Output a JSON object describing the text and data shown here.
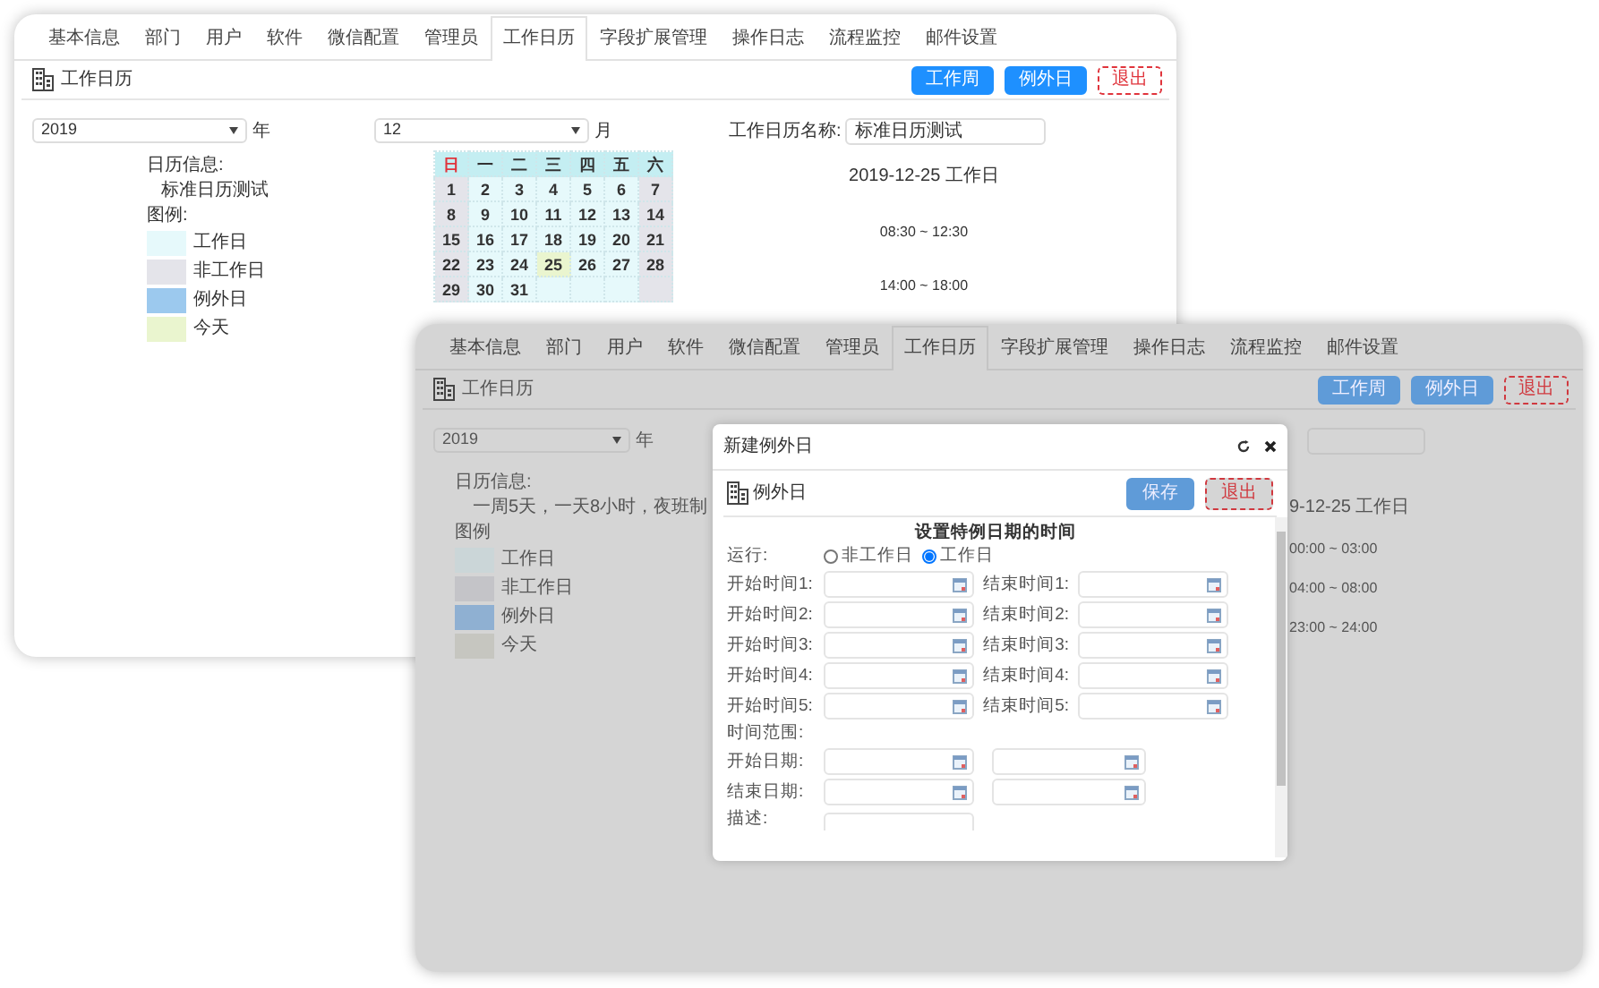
{
  "back_window": {
    "tabs": [
      {
        "label": "基本信息",
        "selected": false
      },
      {
        "label": "部门",
        "selected": false
      },
      {
        "label": "用户",
        "selected": false
      },
      {
        "label": "软件",
        "selected": false
      },
      {
        "label": "微信配置",
        "selected": false
      },
      {
        "label": "管理员",
        "selected": false
      },
      {
        "label": "工作日历",
        "selected": true
      },
      {
        "label": "字段扩展管理",
        "selected": false
      },
      {
        "label": "操作日志",
        "selected": false
      },
      {
        "label": "流程监控",
        "selected": false
      },
      {
        "label": "邮件设置",
        "selected": false
      }
    ],
    "page_title": "工作日历",
    "buttons": [
      {
        "label": "工作周",
        "kind": "primary"
      },
      {
        "label": "例外日",
        "kind": "primary"
      },
      {
        "label": "退出",
        "kind": "danger"
      }
    ],
    "year_select": "2019",
    "year_label": "年",
    "month_select": "12",
    "month_label": "月",
    "name_label": "工作日历名称:",
    "name_value": "标准日历测试",
    "info_label": "日历信息:",
    "info_text": "标准日历测试",
    "legend_label": "图例:",
    "legend": [
      {
        "label": "工作日",
        "color": "#e6f9fb"
      },
      {
        "label": "非工作日",
        "color": "#e4e4ea"
      },
      {
        "label": "例外日",
        "color": "#9cc9ee"
      },
      {
        "label": "今天",
        "color": "#eaf5cf"
      }
    ],
    "calendar": {
      "weekdays": [
        {
          "label": "日",
          "color": "#e0343c"
        },
        {
          "label": "一",
          "color": "#333333"
        },
        {
          "label": "二",
          "color": "#333333"
        },
        {
          "label": "三",
          "color": "#333333"
        },
        {
          "label": "四",
          "color": "#333333"
        },
        {
          "label": "五",
          "color": "#333333"
        },
        {
          "label": "六",
          "color": "#333333"
        }
      ],
      "weeks": [
        [
          {
            "day": "1",
            "kind": "nonwork"
          },
          {
            "day": "2",
            "kind": "work"
          },
          {
            "day": "3",
            "kind": "work"
          },
          {
            "day": "4",
            "kind": "work"
          },
          {
            "day": "5",
            "kind": "work"
          },
          {
            "day": "6",
            "kind": "work"
          },
          {
            "day": "7",
            "kind": "nonwork"
          }
        ],
        [
          {
            "day": "8",
            "kind": "nonwork"
          },
          {
            "day": "9",
            "kind": "work"
          },
          {
            "day": "10",
            "kind": "work"
          },
          {
            "day": "11",
            "kind": "work"
          },
          {
            "day": "12",
            "kind": "work"
          },
          {
            "day": "13",
            "kind": "work"
          },
          {
            "day": "14",
            "kind": "nonwork"
          }
        ],
        [
          {
            "day": "15",
            "kind": "nonwork"
          },
          {
            "day": "16",
            "kind": "work"
          },
          {
            "day": "17",
            "kind": "work"
          },
          {
            "day": "18",
            "kind": "work"
          },
          {
            "day": "19",
            "kind": "work"
          },
          {
            "day": "20",
            "kind": "work"
          },
          {
            "day": "21",
            "kind": "nonwork"
          }
        ],
        [
          {
            "day": "22",
            "kind": "nonwork"
          },
          {
            "day": "23",
            "kind": "work"
          },
          {
            "day": "24",
            "kind": "work"
          },
          {
            "day": "25",
            "kind": "today"
          },
          {
            "day": "26",
            "kind": "work"
          },
          {
            "day": "27",
            "kind": "work"
          },
          {
            "day": "28",
            "kind": "nonwork"
          }
        ],
        [
          {
            "day": "29",
            "kind": "nonwork"
          },
          {
            "day": "30",
            "kind": "work"
          },
          {
            "day": "31",
            "kind": "work"
          },
          {
            "kind": "work"
          },
          {
            "kind": "work"
          },
          {
            "kind": "work"
          },
          {
            "kind": "nonwork"
          }
        ]
      ]
    },
    "detail": {
      "date": "2019-12-25 工作日",
      "times": [
        "08:30 ~ 12:30",
        "14:00 ~ 18:00"
      ]
    }
  },
  "front_window": {
    "tabs": [
      {
        "label": "基本信息",
        "selected": false
      },
      {
        "label": "部门",
        "selected": false
      },
      {
        "label": "用户",
        "selected": false
      },
      {
        "label": "软件",
        "selected": false
      },
      {
        "label": "微信配置",
        "selected": false
      },
      {
        "label": "管理员",
        "selected": false
      },
      {
        "label": "工作日历",
        "selected": true
      },
      {
        "label": "字段扩展管理",
        "selected": false
      },
      {
        "label": "操作日志",
        "selected": false
      },
      {
        "label": "流程监控",
        "selected": false
      },
      {
        "label": "邮件设置",
        "selected": false
      }
    ],
    "page_title": "工作日历",
    "buttons": [
      {
        "label": "工作周",
        "kind": "primary"
      },
      {
        "label": "例外日",
        "kind": "primary"
      },
      {
        "label": "退出",
        "kind": "danger"
      }
    ],
    "year_select": "2019",
    "year_label": "年",
    "info_label": "日历信息:",
    "info_text": "一周5天，一天8小时，夜班制",
    "legend_label": "图例",
    "legend": [
      {
        "label": "工作日",
        "color": "#cbd6d8"
      },
      {
        "label": "非工作日",
        "color": "#c4c4c8"
      },
      {
        "label": "例外日",
        "color": "#8fb0d2"
      },
      {
        "label": "今天",
        "color": "#c6c6c0"
      }
    ],
    "detail": {
      "date": "9-12-25 工作日",
      "times": [
        "00:00 ~ 03:00",
        "04:00 ~ 08:00",
        "23:00 ~ 24:00"
      ]
    }
  },
  "modal": {
    "title": "新建例外日",
    "header_title": "例外日",
    "buttons": [
      {
        "label": "保存",
        "kind": "primary"
      },
      {
        "label": "退出",
        "kind": "danger"
      }
    ],
    "section_title": "设置特例日期的时间",
    "run_label": "运行:",
    "run_options": [
      {
        "label": "非工作日",
        "selected": false
      },
      {
        "label": "工作日",
        "selected": true
      }
    ],
    "time_rows": [
      {
        "start_label": "开始时间1:",
        "end_label": "结束时间1:"
      },
      {
        "start_label": "开始时间2:",
        "end_label": "结束时间2:"
      },
      {
        "start_label": "开始时间3:",
        "end_label": "结束时间3:"
      },
      {
        "start_label": "开始时间4:",
        "end_label": "结束时间4:"
      },
      {
        "start_label": "开始时间5:",
        "end_label": "结束时间5:"
      }
    ],
    "range_label": "时间范围:",
    "date_rows": [
      {
        "label": "开始日期:"
      },
      {
        "label": "结束日期:"
      }
    ],
    "description_label": "描述:"
  }
}
